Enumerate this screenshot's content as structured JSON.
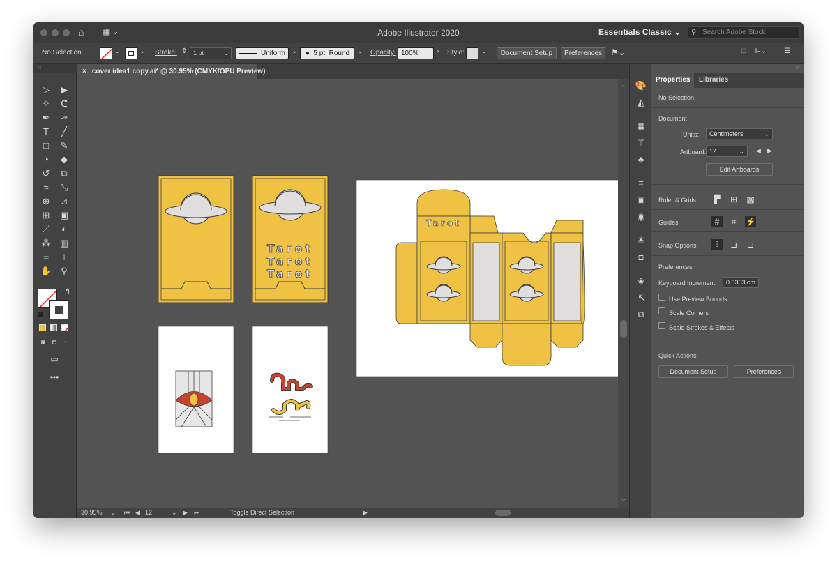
{
  "app": {
    "title": "Adobe Illustrator 2020",
    "workspace": "Essentials Classic",
    "search_placeholder": "Search Adobe Stock"
  },
  "control_bar": {
    "selection": "No Selection",
    "stroke_label": "Stroke:",
    "stroke_value": "1 pt",
    "profile": "Uniform",
    "brush": "5 pt. Round",
    "opacity_label": "Opacity:",
    "opacity_value": "100%",
    "style_label": "Style:",
    "doc_setup": "Document Setup",
    "preferences": "Preferences"
  },
  "document_tab": {
    "title": "cover idea1 copy.ai* @ 30.95% (CMYK/GPU Preview)"
  },
  "artwork": {
    "tarot_text": "Tarot",
    "yellow": "#f0c244",
    "red": "#c8432f",
    "gray": "#e0dede",
    "outline": "#3b3b3b"
  },
  "status_bar": {
    "zoom": "30.95%",
    "artboard": "12",
    "tool": "Toggle Direct Selection"
  },
  "properties": {
    "tabs": [
      "Properties",
      "Libraries"
    ],
    "no_selection": "No Selection",
    "document_title": "Document",
    "units_label": "Units:",
    "units_value": "Centimeters",
    "artboard_label": "Artboard:",
    "artboard_value": "12",
    "edit_artboards": "Edit Artboards",
    "ruler_grids": "Ruler & Grids",
    "guides": "Guides",
    "snap_options": "Snap Options",
    "preferences_title": "Preferences",
    "keyboard_increment_label": "Keyboard Increment:",
    "keyboard_increment_value": "0.0353 cm",
    "use_preview_bounds": "Use Preview Bounds",
    "scale_corners": "Scale Corners",
    "scale_strokes": "Scale Strokes & Effects",
    "quick_actions": "Quick Actions",
    "doc_setup": "Document Setup",
    "preferences": "Preferences"
  }
}
